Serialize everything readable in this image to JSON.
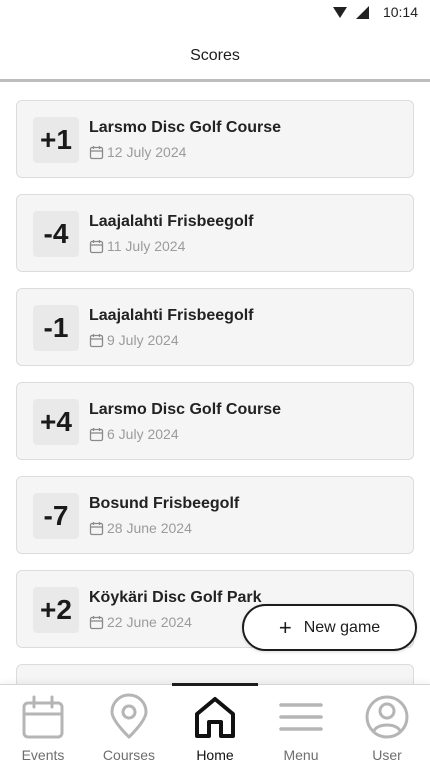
{
  "status_bar": {
    "time": "10:14"
  },
  "header": {
    "title": "Scores"
  },
  "games": [
    {
      "score": "+1",
      "course": "Larsmo Disc Golf Course",
      "date": "12 July 2024"
    },
    {
      "score": "-4",
      "course": "Laajalahti Frisbeegolf",
      "date": "11 July 2024"
    },
    {
      "score": "-1",
      "course": "Laajalahti Frisbeegolf",
      "date": "9 July 2024"
    },
    {
      "score": "+4",
      "course": "Larsmo Disc Golf Course",
      "date": "6 July 2024"
    },
    {
      "score": "-7",
      "course": "Bosund Frisbeegolf",
      "date": "28 June 2024"
    },
    {
      "score": "+2",
      "course": "Köykäri Disc Golf Park",
      "date": "22 June 2024"
    }
  ],
  "fab": {
    "label": "New game",
    "icon": "plus-icon"
  },
  "nav": {
    "active": "Home",
    "items": [
      {
        "label": "Events",
        "icon": "calendar-icon"
      },
      {
        "label": "Courses",
        "icon": "map-pin-icon"
      },
      {
        "label": "Home",
        "icon": "home-icon"
      },
      {
        "label": "Menu",
        "icon": "menu-icon"
      },
      {
        "label": "User",
        "icon": "user-icon"
      }
    ]
  },
  "colors": {
    "card_bg": "#f5f5f5",
    "score_bg": "#e9e9e9",
    "muted": "#9b9b9b",
    "active": "#111111",
    "inactive_icon": "#b5b5b5"
  }
}
